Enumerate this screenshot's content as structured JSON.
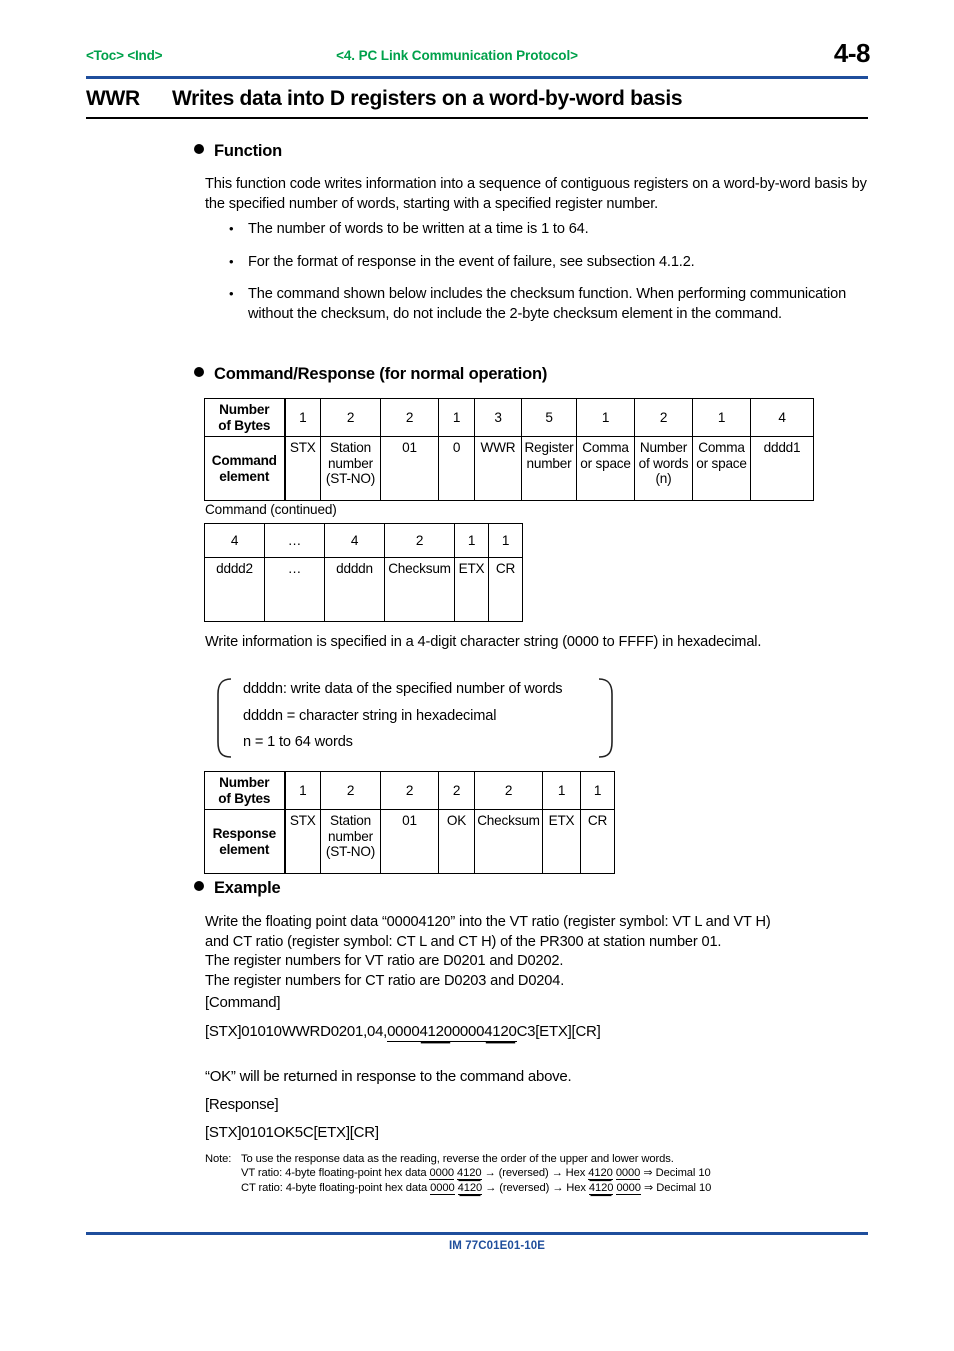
{
  "header": {
    "toc_ind": "<Toc> <Ind>",
    "chapter": "<4.  PC Link Communication Protocol>",
    "page_number": "4-8",
    "accent_green": "#00a14b",
    "accent_blue": "#1f4e9c"
  },
  "section": {
    "code": "WWR",
    "title": "Writes data into D registers on a word-by-word basis"
  },
  "function": {
    "heading": "Function",
    "paragraph": "This function code writes information into a sequence of contiguous registers on a word-by-word basis by the specified number of words, starting with a specified register number.",
    "bullets": [
      "The number of words to be written at a time is 1 to 64.",
      "For the format of response in the event of failure, see subsection 4.1.2.",
      "The command shown below includes the checksum function. When performing communication without the checksum, do not include the 2-byte checksum element in the command."
    ]
  },
  "command_response": {
    "heading": "Command/Response (for normal operation)",
    "command_table": {
      "row_label_bytes": "Number\nof Bytes",
      "row_label_bytes_l1": "Number",
      "row_label_bytes_l2": "of Bytes",
      "row_label_element_l1": "Command",
      "row_label_element_l2": "element",
      "bytes": [
        "1",
        "2",
        "2",
        "1",
        "3",
        "5",
        "1",
        "2",
        "1",
        "4"
      ],
      "elements": [
        "STX",
        "Station number (ST-NO)",
        "01",
        "0",
        "WWR",
        "Register number",
        "Comma or space",
        "Number of words (n)",
        "Comma or space",
        "dddd1"
      ]
    },
    "continued_caption": "Command (continued)",
    "continued_table": {
      "bytes": [
        "4",
        "…",
        "4",
        "2",
        "1",
        "1"
      ],
      "elements": [
        "dddd2",
        "…",
        "ddddn",
        "Checksum",
        "ETX",
        "CR"
      ]
    },
    "write_info_paragraph": "Write information is specified in a 4-digit character string (0000 to FFFF) in hexadecimal.",
    "brace_lines": [
      "ddddn: write data of the specified number of words",
      "ddddn = character string in hexadecimal",
      "n = 1 to 64 words"
    ],
    "response_table": {
      "row_label_bytes_l1": "Number",
      "row_label_bytes_l2": "of Bytes",
      "row_label_element_l1": "Response",
      "row_label_element_l2": "element",
      "bytes": [
        "1",
        "2",
        "2",
        "2",
        "2",
        "1",
        "1"
      ],
      "elements": [
        "STX",
        "Station number (ST-NO)",
        "01",
        "OK",
        "Checksum",
        "ETX",
        "CR"
      ]
    }
  },
  "example": {
    "heading": "Example",
    "paragraph_lines": [
      "Write the floating point data “00004120” into the VT ratio (register symbol: VT L and VT H)",
      "and CT ratio (register symbol: CT L and CT H) of the PR300 at station number 01.",
      "The register numbers for VT ratio are D0201 and D0202.",
      "The register numbers for CT ratio are D0203 and D0204."
    ],
    "command_label": "[Command]",
    "command_parts": {
      "prefix": "[STX]01010WWRD0201,04,",
      "seg1": "0000",
      "seg2": "4120",
      "seg3": "0000",
      "seg4": "4120",
      "suffix": "C3[ETX][CR]"
    },
    "ok_note": "“OK” will be returned in response to the command above.",
    "response_label": "[Response]",
    "response_string": "[STX]0101OK5C[ETX][CR]"
  },
  "note": {
    "label": "Note:",
    "line1": "To use the response data as the reading, reverse the order of the upper and lower words.",
    "vt": {
      "prefix": "VT ratio: 4-byte floating-point hex data ",
      "a": "0000",
      "b": "4120",
      "mid": " → (reversed) → Hex ",
      "c": "4120",
      "d": "0000",
      "suffix": " ⇒ Decimal 10"
    },
    "ct": {
      "prefix": "CT ratio: 4-byte floating-point hex data ",
      "a": "0000",
      "b": "4120",
      "mid": " → (reversed) → Hex ",
      "c": "4120",
      "d": "0000",
      "suffix": " ⇒ Decimal 10"
    }
  },
  "footer": {
    "doc_id": "IM 77C01E01-10E"
  }
}
